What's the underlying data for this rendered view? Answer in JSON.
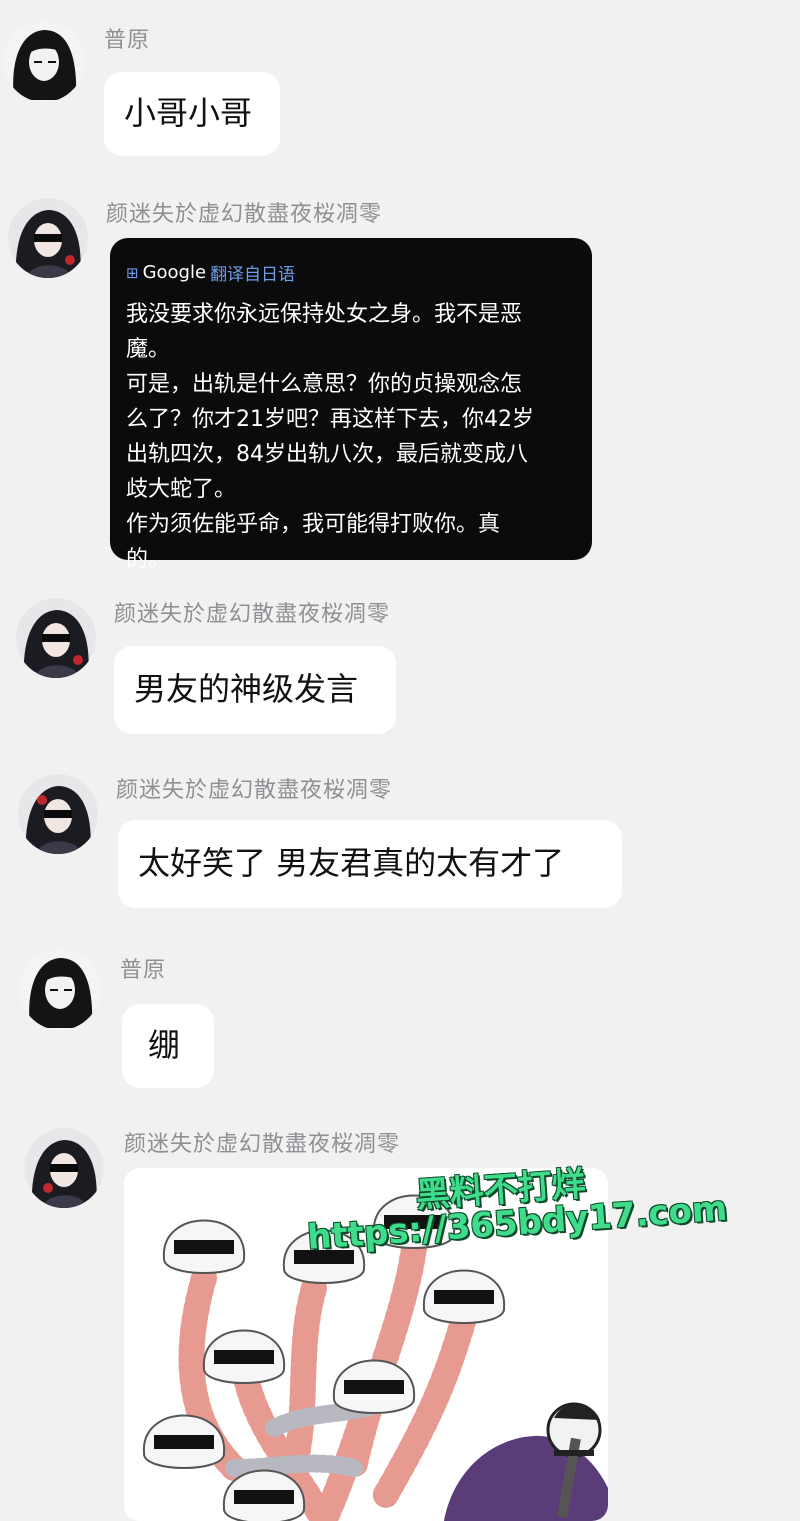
{
  "messages": [
    {
      "sender": "普原",
      "text": "小哥小哥"
    },
    {
      "sender": "颜迷失於虚幻散盡夜桜凋零",
      "translation": {
        "brand": "Google",
        "label": "翻译自日语",
        "lines": [
          "我没要求你永远保持处女之身。我不是恶",
          "魔。",
          "可是，出轨是什么意思？你的贞操观念怎",
          "么了？你才21岁吧？再这样下去，你42岁",
          "出轨四次，84岁出轨八次，最后就变成八",
          "歧大蛇了。",
          "作为须佐能乎命，我可能得打败你。真",
          "的。"
        ]
      }
    },
    {
      "sender": "颜迷失於虚幻散盡夜桜凋零",
      "text": "男友的神级发言"
    },
    {
      "sender": "颜迷失於虚幻散盡夜桜凋零",
      "text": "太好笑了 男友君真的太有才了"
    },
    {
      "sender": "普原",
      "text": "绷"
    },
    {
      "sender": "颜迷失於虚幻散盡夜桜凋零",
      "image_alt": "multi-headed serpent illustration"
    }
  ],
  "watermark": {
    "line1": "黑料不打烊",
    "line2": "https://365bdy17.com"
  },
  "colors": {
    "background": "#f1f1f2",
    "bubble": "#ffffff",
    "translate_bubble": "#0b0b0e",
    "sender_text": "#8f8f94",
    "translate_label": "#6c9fe8",
    "watermark": "#3fdc8c"
  },
  "icons": {
    "translate": "translate-icon",
    "avatar_a": "avatar-ink-girl",
    "avatar_b": "avatar-dark-hair"
  }
}
